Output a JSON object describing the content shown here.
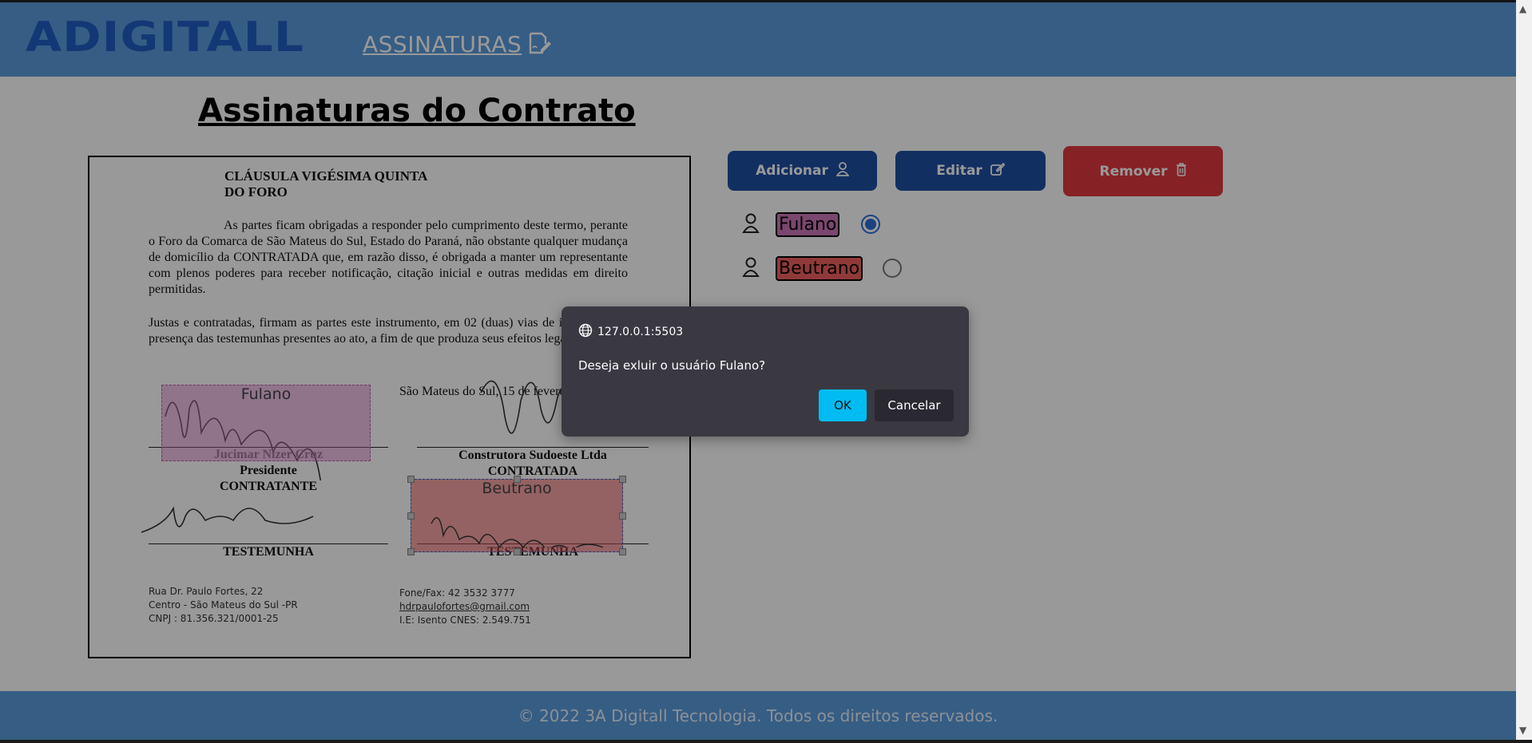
{
  "header": {
    "logo_text": "ADIGITALL",
    "nav_link": "ASSINATURAS",
    "nav_icon": "signature-icon"
  },
  "page": {
    "title": "Assinaturas do Contrato"
  },
  "document": {
    "clause_title_1": "CLÁUSULA VIGÉSIMA QUINTA",
    "clause_title_2": "DO FORO",
    "paragraph_1": "As partes ficam obrigadas a responder pelo cumprimento deste termo, perante o Foro da Comarca de São Mateus do Sul, Estado do Paraná, não obstante qualquer mudança de domicílio da CONTRATADA que, em razão disso, é obrigada a manter um representante com plenos poderes para receber notificação, citação inicial e outras medidas em direito permitidas.",
    "paragraph_2": "Justas e contratadas, firmam as partes este instrumento, em 02 (duas) vias de igual teor, na presença das testemunhas presentes ao ato, a fim de que produza seus efeitos legais.",
    "place_date": "São Mateus do Sul, 15 de fevere",
    "signer_left_name": "Jucimar Nizer Cruz",
    "signer_left_role": "Presidente",
    "signer_left_party": "CONTRATANTE",
    "signer_right_company": "Construtora Sudoeste Ltda",
    "signer_right_party": "CONTRATADA",
    "witness_left": "TESTEMUNHA",
    "witness_right": "TESTEMUNHA",
    "footer_left_1": "Rua Dr. Paulo Fortes, 22",
    "footer_left_2": "Centro - São Mateus do Sul -PR",
    "footer_left_3": "CNPJ : 81.356.321/0001-25",
    "footer_right_1": "Fone/Fax: 42 3532 3777",
    "footer_right_2": "hdrpaulofortes@gmail.com",
    "footer_right_3": "I.E: Isento CNES: 2.549.751",
    "sig_box_fulano": "Fulano",
    "sig_box_beutrano": "Beutrano"
  },
  "actions": {
    "add_label": "Adicionar",
    "edit_label": "Editar",
    "remove_label": "Remover"
  },
  "signers": [
    {
      "name": "Fulano",
      "color": "#cc77b8",
      "selected": true
    },
    {
      "name": "Beutrano",
      "color": "#f06060",
      "selected": false
    }
  ],
  "footer": {
    "copyright": "© 2022 3A Digitall Tecnologia. Todos os direitos reservados."
  },
  "dialog": {
    "origin": "127.0.0.1:5503",
    "message": "Deseja exluir o usuário Fulano?",
    "ok_label": "OK",
    "cancel_label": "Cancelar"
  },
  "colors": {
    "header_bg": "#5b9bdd",
    "primary_button": "#1f4fa3",
    "danger_button": "#e03a3e",
    "dialog_bg": "#3a3942",
    "ok_button": "#00bcf2"
  }
}
